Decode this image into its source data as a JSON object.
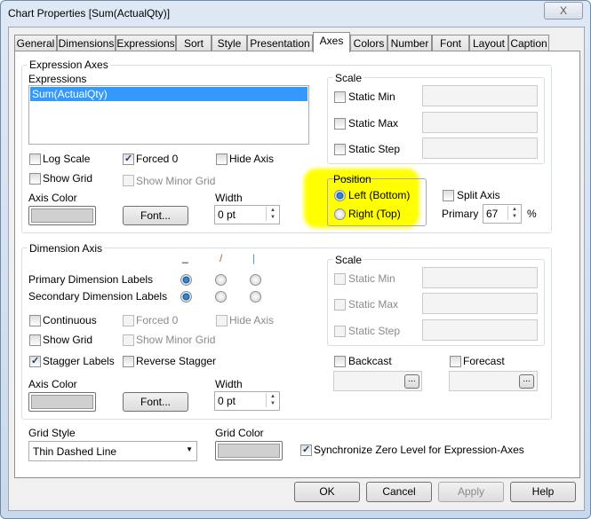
{
  "window": {
    "title": "Chart Properties [Sum(ActualQty)]",
    "close": "X"
  },
  "tabs": [
    "General",
    "Dimensions",
    "Expressions",
    "Sort",
    "Style",
    "Presentation",
    "Axes",
    "Colors",
    "Number",
    "Font",
    "Layout",
    "Caption"
  ],
  "active_tab": "Axes",
  "expression_axes": {
    "group_label": "Expression Axes",
    "expressions_label": "Expressions",
    "expressions": [
      "Sum(ActualQty)"
    ],
    "log_scale": "Log Scale",
    "forced_0": "Forced 0",
    "hide_axis": "Hide Axis",
    "show_grid": "Show Grid",
    "show_minor_grid": "Show Minor Grid",
    "axis_color": "Axis Color",
    "font_button": "Font...",
    "width_label": "Width",
    "width_value": "0 pt",
    "scale": {
      "label": "Scale",
      "static_min": "Static Min",
      "static_max": "Static Max",
      "static_step": "Static Step"
    },
    "position": {
      "label": "Position",
      "left": "Left (Bottom)",
      "right": "Right (Top)",
      "selected": "Left (Bottom)",
      "highlight_color": "#ffff00"
    },
    "split_axis": "Split Axis",
    "primary_label": "Primary",
    "primary_value": "67",
    "percent": "%",
    "checked": {
      "log_scale": false,
      "forced_0": true,
      "hide_axis": false,
      "show_grid": false
    }
  },
  "dimension_axis": {
    "group_label": "Dimension Axis",
    "col_headers": [
      "_",
      "/",
      "|"
    ],
    "primary_labels": "Primary Dimension Labels",
    "secondary_labels": "Secondary Dimension Labels",
    "continuous": "Continuous",
    "forced_0": "Forced 0",
    "hide_axis": "Hide Axis",
    "show_grid": "Show Grid",
    "show_minor_grid": "Show Minor Grid",
    "stagger_labels": "Stagger Labels",
    "reverse_stagger": "Reverse Stagger",
    "axis_color": "Axis Color",
    "font_button": "Font...",
    "width_label": "Width",
    "width_value": "0 pt",
    "scale": {
      "label": "Scale",
      "static_min": "Static Min",
      "static_max": "Static Max",
      "static_step": "Static Step"
    },
    "backcast": "Backcast",
    "forecast": "Forecast",
    "ellipsis": "...",
    "checked": {
      "stagger_labels": true
    }
  },
  "grid_style": {
    "label": "Grid Style",
    "value": "Thin Dashed Line"
  },
  "grid_color": {
    "label": "Grid Color"
  },
  "sync_zero": {
    "label": "Synchronize Zero Level for Expression-Axes",
    "checked": true
  },
  "buttons": {
    "ok": "OK",
    "cancel": "Cancel",
    "apply": "Apply",
    "help": "Help"
  }
}
